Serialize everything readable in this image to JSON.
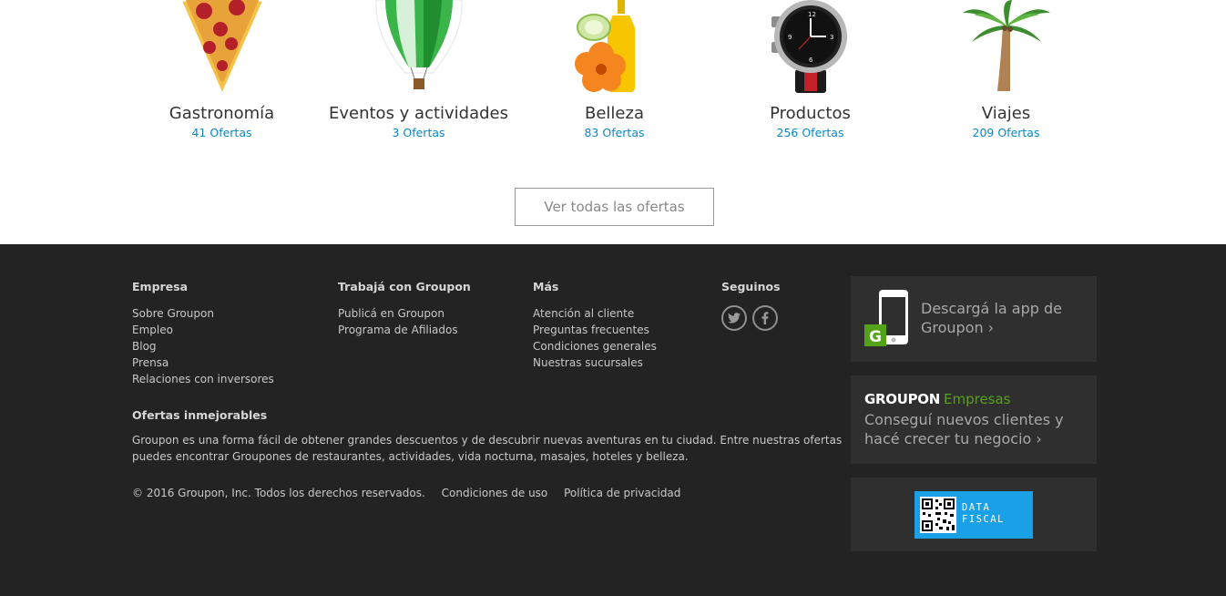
{
  "categories": [
    {
      "name": "Gastronomía",
      "count": "41 Ofertas",
      "icon": "pizza-slice-icon"
    },
    {
      "name": "Eventos y actividades",
      "count": "3 Ofertas",
      "icon": "hot-air-balloon-icon"
    },
    {
      "name": "Belleza",
      "count": "83 Ofertas",
      "icon": "beauty-oil-flower-icon"
    },
    {
      "name": "Productos",
      "count": "256 Ofertas",
      "icon": "wristwatch-icon"
    },
    {
      "name": "Viajes",
      "count": "209 Ofertas",
      "icon": "palm-tree-icon"
    }
  ],
  "see_all_label": "Ver todas las ofertas",
  "footer": {
    "empresa": {
      "title": "Empresa",
      "links": [
        "Sobre Groupon",
        "Empleo",
        "Blog",
        "Prensa",
        "Relaciones con inversores"
      ]
    },
    "trabaja": {
      "title": "Trabajá con Groupon",
      "links": [
        "Publicá en Groupon",
        "Programa de Afiliados"
      ]
    },
    "mas": {
      "title": "Más",
      "links": [
        "Atención al cliente",
        "Preguntas frecuentes",
        "Condiciones generales",
        "Nuestras sucursales"
      ]
    },
    "seguinos": {
      "title": "Seguinos",
      "icons": [
        "twitter-icon",
        "facebook-icon"
      ]
    },
    "ofertas": {
      "title": "Ofertas inmejorables",
      "text": "Groupon es una forma fácil de obtener grandes descuentos y de descubrir nuevas aventuras en tu ciudad. Entre nuestras ofertas puedes encontrar Groupones de restaurantes, actividades, vida nocturna, masajes, hoteles y belleza."
    },
    "legal": {
      "copyright": "© 2016 Groupon, Inc. Todos los derechos reservados.",
      "terms": "Condiciones de uso",
      "privacy": "Política de privacidad"
    },
    "app": {
      "line1": "Descargá la app de",
      "line2": "Groupon ›"
    },
    "empresas": {
      "brand": "GROUPON",
      "brand_suffix": "Empresas",
      "line1": "Conseguí nuevos clientes y",
      "line2": "hacé crecer tu negocio ›"
    },
    "fiscal": {
      "line1": "DATA",
      "line2": "FISCAL"
    }
  },
  "colors": {
    "link_blue": "#0a87c6",
    "footer_bg": "#232323",
    "box_bg": "#2f2f2f",
    "groupon_green": "#53a318",
    "fiscal_blue": "#1aa0e6"
  }
}
